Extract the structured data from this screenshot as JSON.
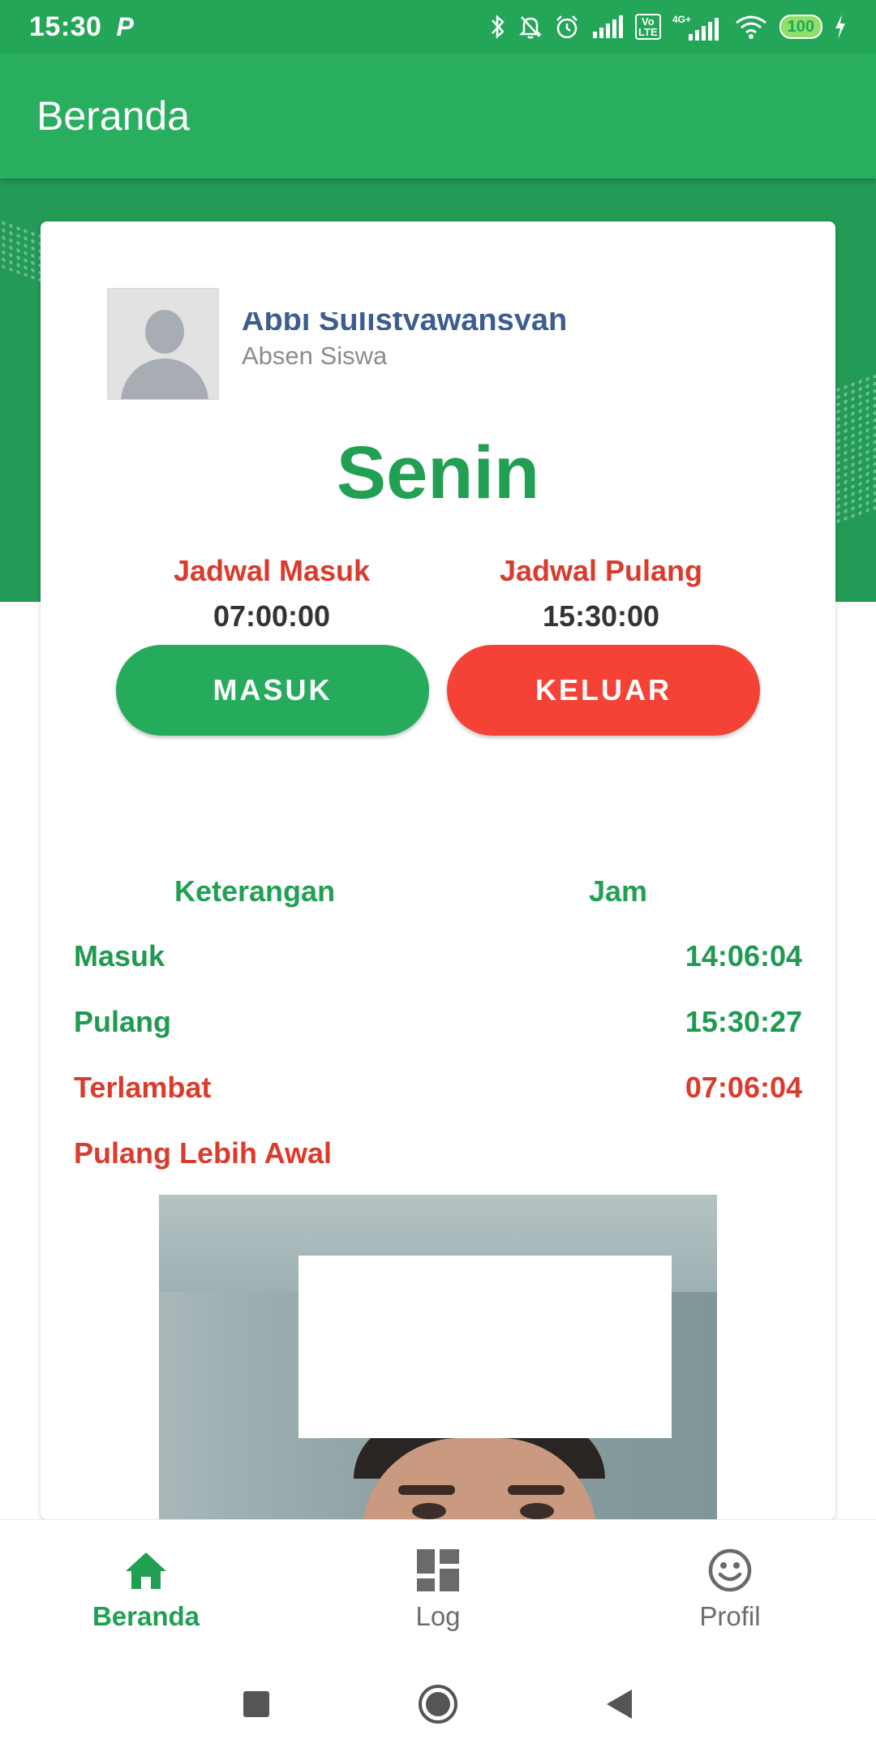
{
  "status_bar": {
    "time": "15:30",
    "notification": "P",
    "network_label": "4G+",
    "volte_label": "Vo LTE",
    "battery": "100"
  },
  "app_bar": {
    "title": "Beranda"
  },
  "profile": {
    "name": "Abbi Sulistyawansyah",
    "subtitle": "Absen Siswa"
  },
  "day": "Senin",
  "schedule": {
    "in_label": "Jadwal Masuk",
    "in_time": "07:00:00",
    "out_label": "Jadwal Pulang",
    "out_time": "15:30:00"
  },
  "buttons": {
    "in": "MASUK",
    "out": "KELUAR"
  },
  "log": {
    "header_desc": "Keterangan",
    "header_time": "Jam",
    "rows": [
      {
        "label": "Masuk",
        "value": "14:06:04",
        "color": "#1f9a50"
      },
      {
        "label": "Pulang",
        "value": "15:30:27",
        "color": "#1f9a50"
      },
      {
        "label": "Terlambat",
        "value": "07:06:04",
        "color": "#d93b2d"
      },
      {
        "label": "Pulang Lebih Awal",
        "value": "",
        "color": "#d93b2d"
      }
    ]
  },
  "bottom_nav": [
    {
      "label": "Beranda",
      "icon": "home-icon",
      "active": true
    },
    {
      "label": "Log",
      "icon": "dashboard-icon",
      "active": false
    },
    {
      "label": "Profil",
      "icon": "smiley-icon",
      "active": false
    }
  ],
  "colors": {
    "primary": "#29ae60",
    "primary_dark": "#24a659",
    "accent_red": "#f44336",
    "label_red": "#d93b2d"
  }
}
